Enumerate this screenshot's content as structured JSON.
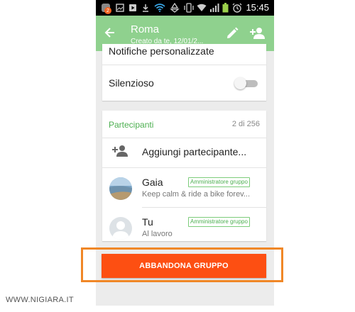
{
  "status_bar": {
    "time": "15:45",
    "notification_count": "2",
    "icons": [
      "notification-badge-icon",
      "image-icon",
      "play-icon",
      "download-icon",
      "wifi-icon",
      "recycle-icon",
      "vibrate-icon",
      "wifi-icon",
      "signal-icon",
      "battery-icon",
      "alarm-icon"
    ]
  },
  "app_bar": {
    "title": "Roma",
    "subtitle": "Creato da te, 12/01/2...",
    "color": "#8fd18e"
  },
  "settings": {
    "custom_notifications_label": "Notifiche personalizzate",
    "silent_label": "Silenzioso",
    "silent_enabled": false
  },
  "participants": {
    "header": "Partecipanti",
    "count": "2 di 256",
    "add_label": "Aggiungi partecipante...",
    "items": [
      {
        "name": "Gaia",
        "status": "Keep calm & ride a bike forev...",
        "badge": "Amministratore gruppo"
      },
      {
        "name": "Tu",
        "status": "Al lavoro",
        "badge": "Amministratore gruppo"
      }
    ]
  },
  "leave_button": {
    "label": "ABBANDONA GRUPPO",
    "color": "#fd4f12"
  },
  "highlight_color": "#f08727",
  "watermark": "WWW.NIGIARA.IT"
}
